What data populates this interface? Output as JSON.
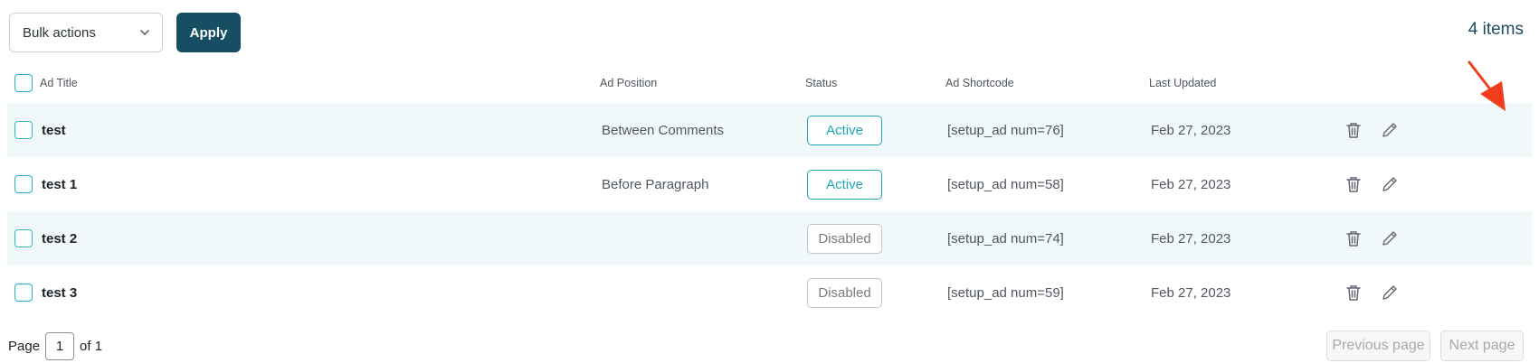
{
  "toolbar": {
    "bulk_actions_label": "Bulk actions",
    "apply_label": "Apply",
    "items_count": "4 items"
  },
  "table": {
    "headers": {
      "title": "Ad Title",
      "position": "Ad Position",
      "status": "Status",
      "shortcode": "Ad Shortcode",
      "updated": "Last Updated"
    },
    "rows": [
      {
        "title": "test",
        "position": "Between Comments",
        "status": "Active",
        "shortcode": "[setup_ad num=76]",
        "updated": "Feb 27, 2023"
      },
      {
        "title": "test 1",
        "position": "Before Paragraph",
        "status": "Active",
        "shortcode": "[setup_ad num=58]",
        "updated": "Feb 27, 2023"
      },
      {
        "title": "test 2",
        "position": "",
        "status": "Disabled",
        "shortcode": "[setup_ad num=74]",
        "updated": "Feb 27, 2023"
      },
      {
        "title": "test 3",
        "position": "",
        "status": "Disabled",
        "shortcode": "[setup_ad num=59]",
        "updated": "Feb 27, 2023"
      }
    ]
  },
  "pagination": {
    "page_label": "Page",
    "current_page": "1",
    "of_label": "of 1",
    "previous_label": "Previous page",
    "next_label": "Next page"
  },
  "icons": {
    "delete": "trash-icon",
    "edit": "pencil-icon",
    "annotation": "red-arrow-icon"
  },
  "colors": {
    "primary": "#164e63",
    "accent": "#1ea6b4",
    "row_alt": "#f1f8fa",
    "annotation": "#f23c1e"
  }
}
